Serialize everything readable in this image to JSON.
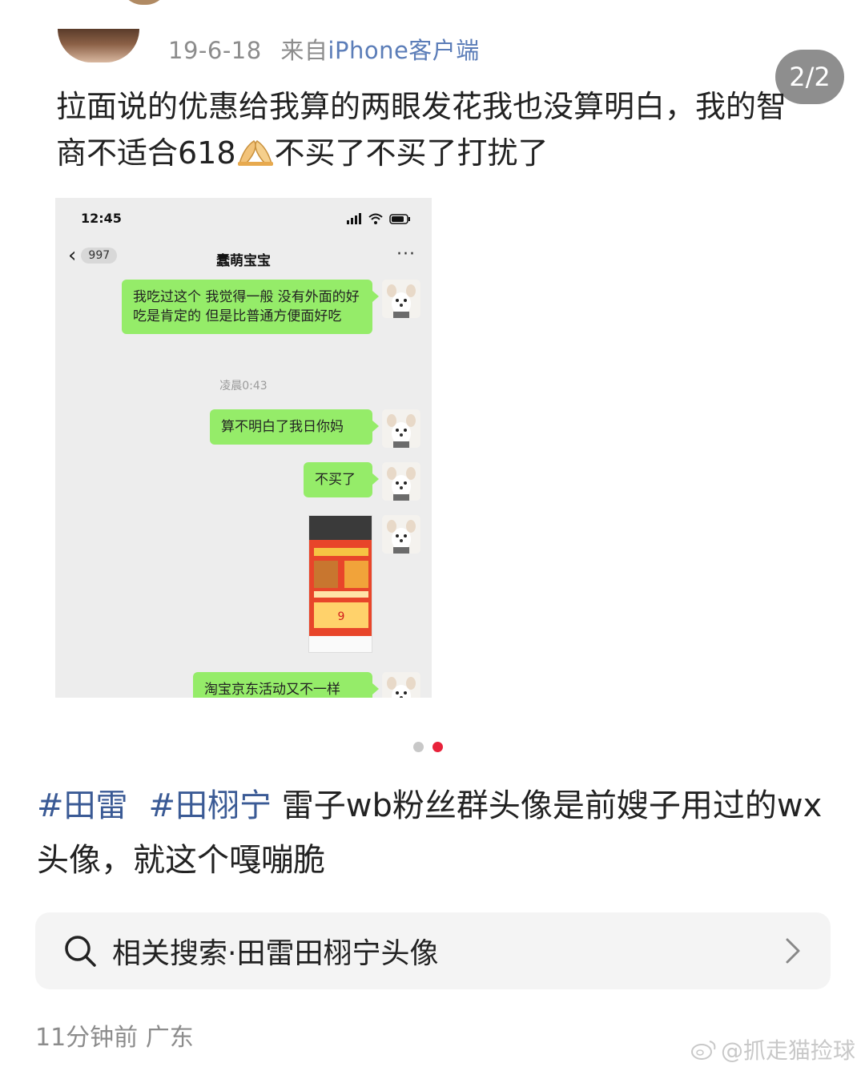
{
  "post": {
    "date": "19-6-18",
    "source_prefix": "来自",
    "source": "iPhone客户端",
    "image_counter": "2/2",
    "text_before_emoji": "拉面说的优惠给我算的两眼发花我也没算明白，我的智商不适合618",
    "text_after_emoji": "不买了不买了打扰了",
    "emoji_icon": "folded-hands-icon"
  },
  "chat_screenshot": {
    "status_time": "12:45",
    "back_badge": "997",
    "chat_title": "蠢萌宝宝",
    "more": "···",
    "messages": [
      {
        "text": "我吃过这个 我觉得一般 没有外面的好吃是肯定的 但是比普通方便面好吃"
      },
      {
        "text": "算不明白了我日你妈"
      },
      {
        "text": "不买了"
      },
      {
        "text": "淘宝京东活动又不一样"
      }
    ],
    "timestamp": "凌晨0:43"
  },
  "carousel": {
    "total": 2,
    "active_index": 1,
    "active_color": "#e8223a",
    "inactive_color": "#c8c8c8"
  },
  "caption": {
    "tag1": "#田雷",
    "tag2": "#田栩宁",
    "text": " 雷子wb粉丝群头像是前嫂子用过的wx头像，就这个嘎嘣脆"
  },
  "related_search": {
    "label": "相关搜索·田雷田栩宁头像"
  },
  "footer": {
    "time_location": "11分钟前 广东",
    "watermark": "@抓走猫捡球"
  },
  "colors": {
    "link": "#3a5a95",
    "bubble": "#95ec69",
    "muted": "#8c8c8c"
  }
}
